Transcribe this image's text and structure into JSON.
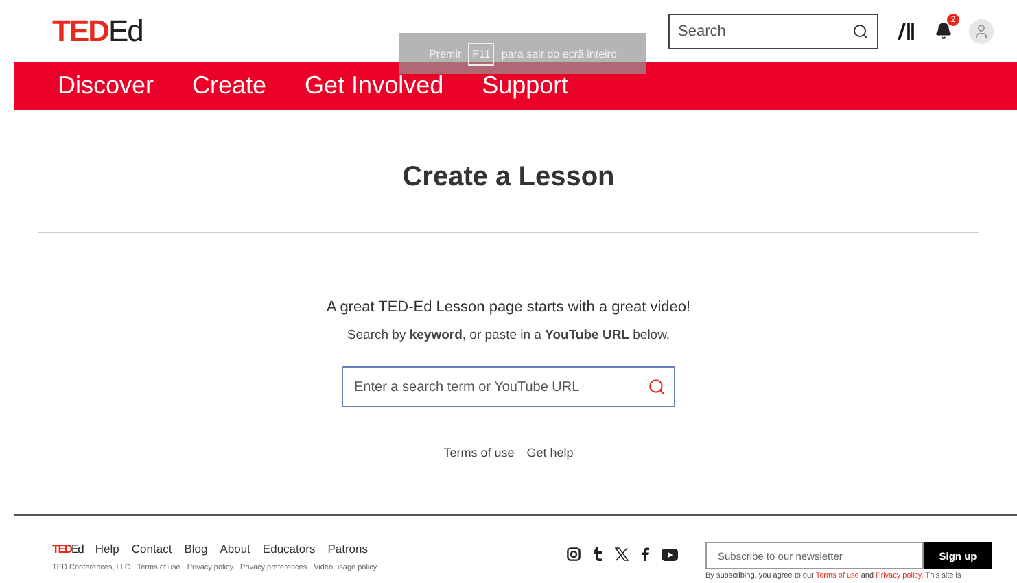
{
  "header": {
    "logo": {
      "ted": "TED",
      "ed": "Ed"
    },
    "search": {
      "placeholder": "Search"
    },
    "notifications": {
      "count": "2"
    }
  },
  "fullscreen_notice": {
    "before": "Premir",
    "key": "F11",
    "after": "para sair do ecrã inteiro"
  },
  "nav": [
    {
      "label": "Discover"
    },
    {
      "label": "Create"
    },
    {
      "label": "Get Involved"
    },
    {
      "label": "Support"
    }
  ],
  "main": {
    "title": "Create a Lesson",
    "intro": "A great TED-Ed Lesson page starts with a great video!",
    "hint": "Search by **keyword**, or paste in a **YouTube URL** below.",
    "search": {
      "placeholder": "Enter a search term or YouTube URL"
    },
    "links": [
      "Terms of use",
      "Get help"
    ]
  },
  "footer": {
    "logo": {
      "ted": "TED",
      "ed": "Ed"
    },
    "links": [
      "Help",
      "Contact",
      "Blog",
      "About",
      "Educators",
      "Patrons"
    ],
    "legal": [
      "TED Conferences, LLC",
      "Terms of use",
      "Privacy policy",
      "Privacy preferences",
      "Video usage policy"
    ],
    "social": [
      {
        "kind": "instagram"
      },
      {
        "kind": "tumblr"
      },
      {
        "kind": "x"
      },
      {
        "kind": "facebook"
      },
      {
        "kind": "youtube"
      }
    ],
    "newsletter": {
      "placeholder": "Subscribe to our newsletter",
      "button": "Sign up",
      "note_before": "By subscribing, you agree to our",
      "terms": "Terms of use",
      "and": "and",
      "privacy": "Privacy policy.",
      "note_after": "This site is"
    }
  }
}
